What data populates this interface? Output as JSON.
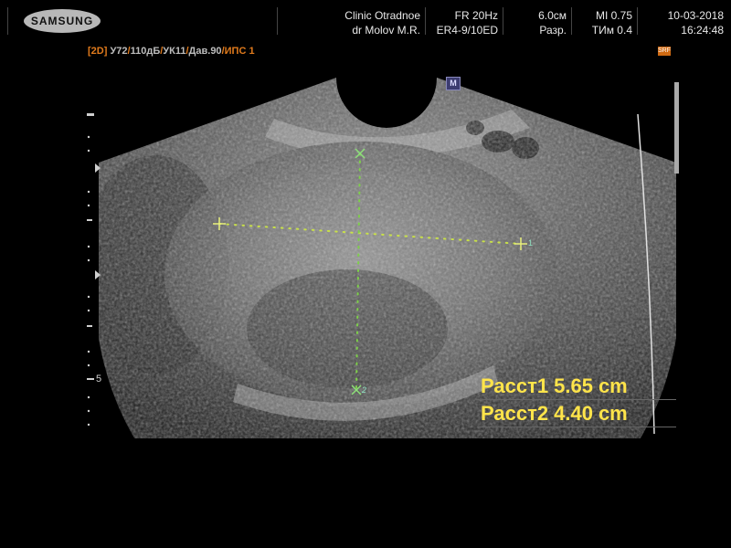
{
  "header": {
    "logo_text": "SAMSUNG",
    "clinic": "Clinic  Otradnoe",
    "doctor": "dr Molov M.R.",
    "frame_rate": "FR 20Hz",
    "probe": "ER4-9/10ED",
    "depth": "6.0см",
    "resolution_label": "Разр.",
    "mi": "MI  0.75",
    "tim": "TИм 0.4",
    "date": "10-03-2018",
    "time": "16:24:48"
  },
  "mode_bar": {
    "mode": "[2D]",
    "gain": "У72",
    "dynamic_range": "110дБ",
    "frame_avg": "УК11",
    "pressure": "Дав.90",
    "ips": "ИПС 1"
  },
  "markers": {
    "srf": "SRF",
    "orientation": "M",
    "depth_scale_label": "5",
    "caliper1_index": "1",
    "caliper2_index": "2"
  },
  "measurements": [
    {
      "label": "Расст1",
      "value": "5.65",
      "unit": "cm"
    },
    {
      "label": "Расст2",
      "value": "4.40",
      "unit": "cm"
    }
  ],
  "colors": {
    "caliper": "#c8e04a",
    "measurement_text": "#ffe44a",
    "mode_accent": "#e07a1c"
  }
}
